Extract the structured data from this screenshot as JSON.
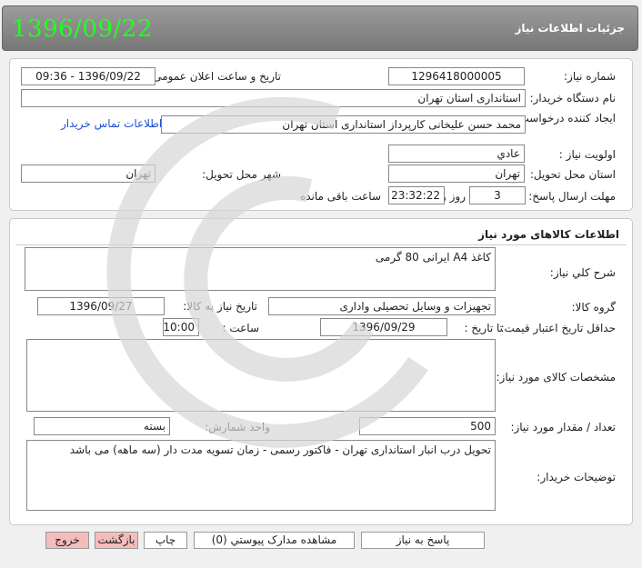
{
  "header": {
    "date": "1396/09/22",
    "title": "جزئیات اطلاعات نیاز"
  },
  "info": {
    "need_number_label": "شماره نیاز:",
    "need_number": "1296418000005",
    "announce_label": "تاریخ و ساعت اعلان عمومی:",
    "announce_value": "1396/09/22 - 09:36",
    "buyer_label": "نام دستگاه خریدار:",
    "buyer_value": "استانداری استان تهران",
    "creator_label": "ایجاد کننده درخواست:",
    "creator_value": "محمد حسن  علیخانی کارپرداز استانداری استان تهران",
    "contact_link": "اطلاعات تماس خریدار",
    "priority_label": "اولویت نیاز :",
    "priority_value": "عادي",
    "province_label": "استان محل تحویل:",
    "province_value": "تهران",
    "city_label": "شهر محل تحویل:",
    "city_value": "تهران",
    "deadline_label": "مهلت ارسال پاسخ:",
    "days_value": "3",
    "days_word": "روز و",
    "time_value": "23:32:22",
    "remaining_label": "ساعت باقی مانده"
  },
  "goods": {
    "section_title": "اطلاعات کالاهای مورد نیاز",
    "desc_label": "شرح کلي نیاز:",
    "desc_value": "کاغذ A4 ایرانی 80 گرمی",
    "group_label": "گروه کالا:",
    "group_value": "تجهیزات و وسایل تحصیلی واداری",
    "need_date_label": "تاریخ نیاز به کالا:",
    "need_date_value": "1396/09/27",
    "min_validity_label": "حداقل تاریخ اعتبار قیمت:",
    "until_date_label": "تا تاریخ :",
    "until_date_value": "1396/09/29",
    "hour_label": "ساعت :",
    "hour_value": "10:00",
    "spec_label": "مشخصات کالای مورد نیاز:",
    "spec_value": "",
    "qty_label": "تعداد / مقدار مورد نیاز:",
    "qty_value": "500",
    "unit_label": "واحد شمارش:",
    "unit_value": "بسته",
    "notes_label": "توضیحات خریدار:",
    "notes_value": "تحویل درب انبار استانداری تهران - فاکتور رسمی - زمان تسویه مدت دار (سه ماهه) می باشد"
  },
  "buttons": {
    "reply": "پاسخ به نیاز",
    "attachments": "مشاهده مدارک پیوستي (0)",
    "print": "چاپ",
    "back": "بازگشت",
    "exit": "خروج"
  }
}
